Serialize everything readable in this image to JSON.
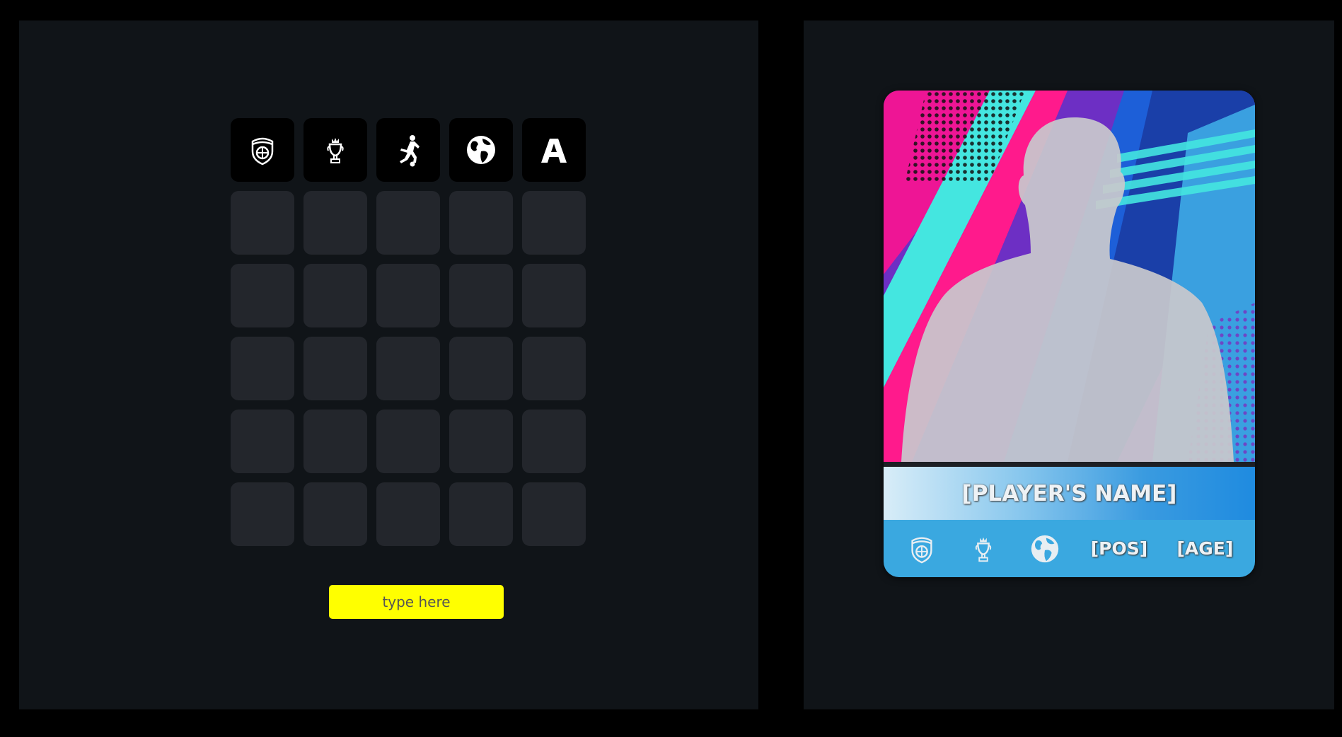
{
  "grid": {
    "columns": [
      {
        "icon": "club-crest-icon"
      },
      {
        "icon": "league-trophy-icon"
      },
      {
        "icon": "position-kicker-icon"
      },
      {
        "icon": "globe-icon"
      },
      {
        "icon": "age-letter-icon",
        "text": "A"
      }
    ],
    "rows": 5
  },
  "guess_input": {
    "placeholder": "type here",
    "value": ""
  },
  "card": {
    "name": "[PLAYER'S NAME]",
    "position": "[POS]",
    "age": "[AGE]",
    "info_icons": [
      "club-crest-icon",
      "league-trophy-icon",
      "globe-icon"
    ]
  },
  "colors": {
    "background": "#000000",
    "panel": "#101418",
    "cell": "#23262c",
    "header_cell": "#000000",
    "input": "#ffff00",
    "card_info_bar": "#3aa8e0"
  }
}
